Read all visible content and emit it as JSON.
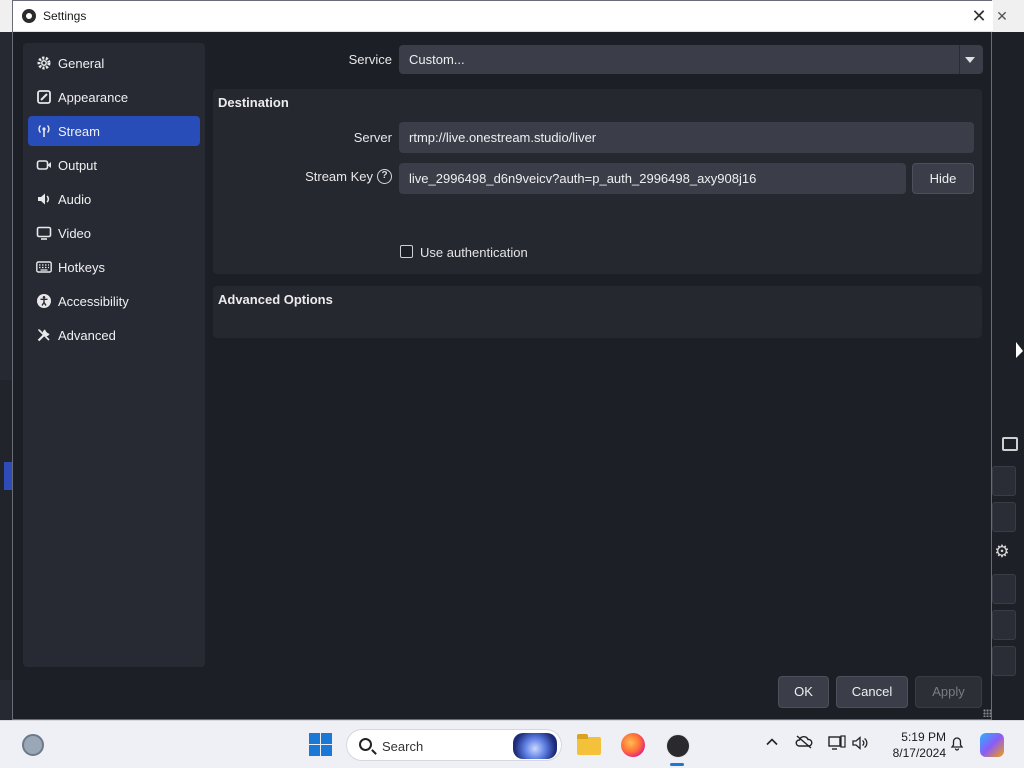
{
  "dialog": {
    "title": "Settings",
    "close_symbol": "✕"
  },
  "sidebar": {
    "items": [
      {
        "label": "General",
        "icon": "gear-icon"
      },
      {
        "label": "Appearance",
        "icon": "appearance-icon"
      },
      {
        "label": "Stream",
        "icon": "broadcast-icon",
        "active": true
      },
      {
        "label": "Output",
        "icon": "output-icon"
      },
      {
        "label": "Audio",
        "icon": "speaker-icon"
      },
      {
        "label": "Video",
        "icon": "monitor-icon"
      },
      {
        "label": "Hotkeys",
        "icon": "keyboard-icon"
      },
      {
        "label": "Accessibility",
        "icon": "accessibility-icon"
      },
      {
        "label": "Advanced",
        "icon": "tools-icon"
      }
    ]
  },
  "stream": {
    "service_label": "Service",
    "service_value": "Custom...",
    "destination_title": "Destination",
    "server_label": "Server",
    "server_value": "rtmp://live.onestream.studio/liver",
    "stream_key_label": "Stream Key",
    "stream_key_value": "live_2996498_d6n9veicv?auth=p_auth_2996498_axy908j16",
    "hide_button": "Hide",
    "use_auth_label": "Use authentication",
    "use_auth_checked": false,
    "advanced_title": "Advanced Options"
  },
  "footer": {
    "ok": "OK",
    "cancel": "Cancel",
    "apply": "Apply"
  },
  "taskbar": {
    "search_placeholder": "Search",
    "time": "5:19 PM",
    "date": "8/17/2024"
  },
  "colors": {
    "accent": "#284cb8",
    "dialog_bg": "#1d1f26",
    "panel_bg": "#272a33"
  }
}
